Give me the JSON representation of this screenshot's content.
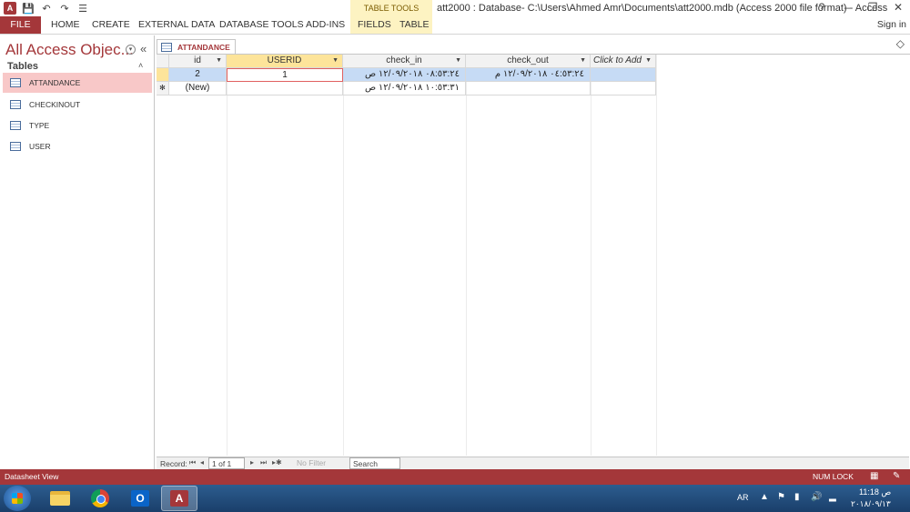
{
  "window": {
    "title": "att2000 : Database- C:\\Users\\Ahmed Amr\\Documents\\att2000.mdb (Access 2000 file format) - Access",
    "controls": [
      "?",
      "–",
      "❐",
      "✕"
    ]
  },
  "qat": {
    "app_icon": "A",
    "save": "💾",
    "undo": "↶",
    "redo": "↷",
    "more": "☰"
  },
  "ribbon": {
    "contextual_group": "TABLE TOOLS",
    "tabs": [
      "FILE",
      "HOME",
      "CREATE",
      "EXTERNAL DATA",
      "DATABASE TOOLS",
      "ADD-INS",
      "FIELDS",
      "TABLE"
    ],
    "sign_in": "Sign in",
    "collapse_icon": "◇"
  },
  "nav": {
    "title": "All Access Objec...",
    "group": "Tables",
    "items": [
      "ATTANDANCE",
      "CHECKINOUT",
      "TYPE",
      "USER"
    ],
    "selected": "ATTANDANCE",
    "shutter_icon": "«",
    "dropdown_icon": "▾",
    "group_chevron": "˄"
  },
  "document": {
    "tab": "ATTANDANCE",
    "columns": [
      "id",
      "USERID",
      "check_in",
      "check_out",
      "Click to Add"
    ],
    "rows": [
      {
        "selector": "",
        "id": "2",
        "USERID": "1",
        "check_in": "٠٨:٥٣:٢٤ ١٢/٠٩/٢٠١٨ ص",
        "check_out": "٠٤:٥٣:٢٤ ١٢/٠٩/٢٠١٨ م"
      },
      {
        "selector": "✻",
        "id": "(New)",
        "USERID": "",
        "check_in": "١٠:٥٣:٣١ ١٢/٠٩/٢٠١٨ ص",
        "check_out": ""
      }
    ]
  },
  "record_nav": {
    "label": "Record:",
    "first": "⏮",
    "prev": "◂",
    "current": "1 of 1",
    "next": "▸",
    "last": "⏭",
    "new": "▸✱",
    "filter": "No Filter",
    "search_placeholder": "Search"
  },
  "status": {
    "view": "Datasheet View",
    "numlock": "NUM LOCK"
  },
  "taskbar": {
    "language": "AR",
    "time": "11:18 ص",
    "date": "٢٠١٨/٠٩/١٣"
  }
}
